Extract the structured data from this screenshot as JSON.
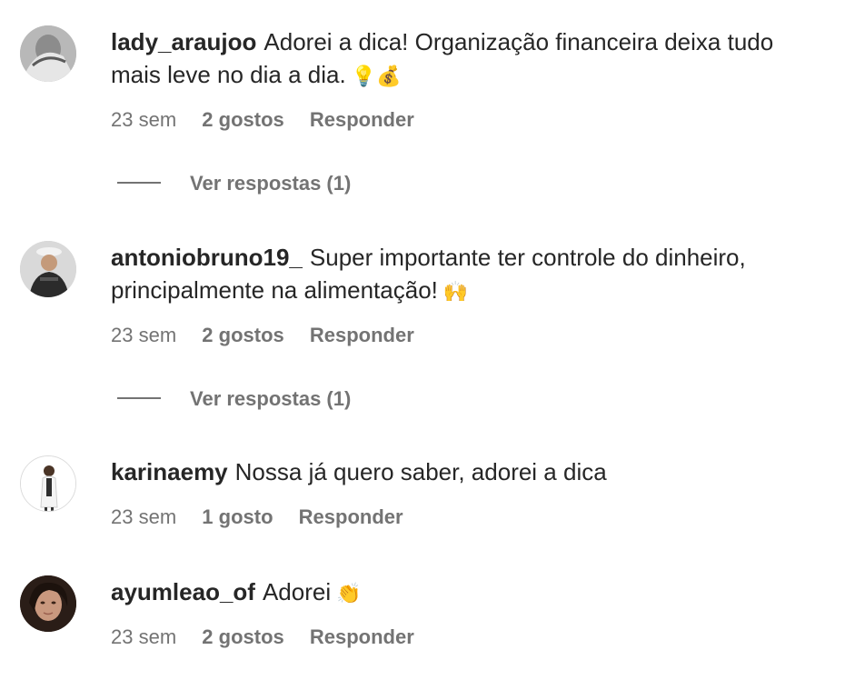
{
  "comments": [
    {
      "username": "lady_araujoo",
      "text": "Adorei a dica! Organização financeira deixa tudo mais leve no dia a dia.",
      "emoji": "💡💰",
      "time": "23 sem",
      "likes": "2 gostos",
      "reply": "Responder",
      "view_replies": "Ver respostas (1)"
    },
    {
      "username": "antoniobruno19_",
      "text": "Super importante ter controle do dinheiro, principalmente na alimentação!",
      "emoji": "🙌",
      "time": "23 sem",
      "likes": "2 gostos",
      "reply": "Responder",
      "view_replies": "Ver respostas (1)"
    },
    {
      "username": "karinaemy",
      "text": "Nossa já quero saber, adorei a dica",
      "emoji": "",
      "time": "23 sem",
      "likes": "1 gosto",
      "reply": "Responder"
    },
    {
      "username": "ayumleao_of",
      "text": "Adorei",
      "emoji": "👏",
      "time": "23 sem",
      "likes": "2 gostos",
      "reply": "Responder"
    }
  ]
}
